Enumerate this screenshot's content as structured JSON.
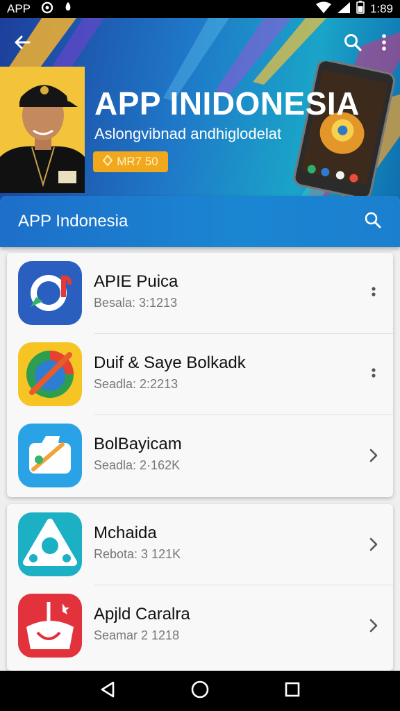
{
  "status_bar": {
    "left_text": "APP",
    "time": "1:89"
  },
  "hero": {
    "title": "APP INIDONESIA",
    "subtitle": "Aslongvibnad andhiglodelat",
    "badge_text": "MR7 50"
  },
  "app_bar": {
    "title": "APP Indonesia"
  },
  "apps": [
    {
      "title": "APIE Puica",
      "meta": "Besala: 3:1213",
      "action": "more-vertical-icon"
    },
    {
      "title": "Duif & Saye Bolkadk",
      "meta": "Seadla: 2:2213",
      "action": "more-vertical-icon"
    },
    {
      "title": "BolBayicam",
      "meta": "Seadla: 2·162K",
      "action": "chevron-right-icon"
    },
    {
      "title": "Mchaida",
      "meta": "Rebota: 3 121K",
      "action": "chevron-right-icon"
    },
    {
      "title": "Apjld Caralra",
      "meta": "Seamar 2 1218",
      "action": "chevron-right-icon"
    }
  ],
  "colors": {
    "app_bar": "#1a86d2",
    "badge": "#f2a81d",
    "icon_1": "#2a5fc0",
    "icon_2": "#f6c423",
    "icon_3": "#29a3e6",
    "icon_4": "#1bb0c4",
    "icon_5": "#e2323b"
  }
}
